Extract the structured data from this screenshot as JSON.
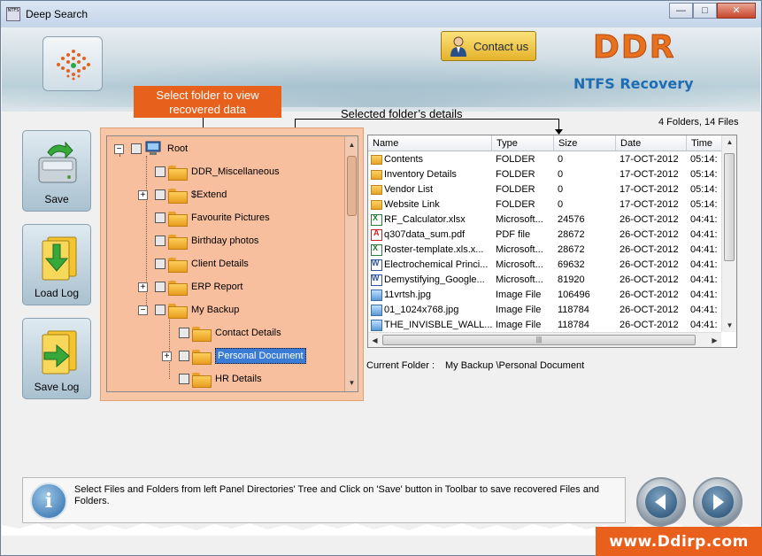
{
  "window": {
    "title": "Deep Search",
    "app_icon_text": "NTFS",
    "controls": {
      "minimize": "—",
      "maximize": "□",
      "close": "✕"
    }
  },
  "header": {
    "contact_label": "Contact us",
    "brand": "DDR",
    "product": "NTFS Recovery",
    "brand_color": "#e8711d",
    "product_color": "#1e6db3"
  },
  "toolbar": {
    "save_label": "Save",
    "load_log_label": "Load Log",
    "save_log_label": "Save Log"
  },
  "annotations": {
    "select_folder": "Select folder to view recovered data",
    "selected_details": "Selected folder’s details",
    "accent": "#e8611c"
  },
  "summary": "4 Folders,  14 Files",
  "tree": {
    "root": "Root",
    "items": [
      {
        "label": "DDR_Miscellaneous",
        "expander": ""
      },
      {
        "label": "$Extend",
        "expander": "+"
      },
      {
        "label": "Favourite Pictures",
        "expander": ""
      },
      {
        "label": "Birthday photos",
        "expander": ""
      },
      {
        "label": "Client Details",
        "expander": ""
      },
      {
        "label": "ERP Report",
        "expander": "+"
      },
      {
        "label": "My Backup",
        "expander": "−"
      },
      {
        "label": "Contact Details",
        "expander": ""
      },
      {
        "label": "Personal Document",
        "expander": "+",
        "selected": true
      },
      {
        "label": "HR Details",
        "expander": ""
      }
    ]
  },
  "files": {
    "columns": [
      "Name",
      "Type",
      "Size",
      "Date",
      "Time"
    ],
    "rows": [
      {
        "icon": "folder",
        "name": "Contents",
        "type": "FOLDER",
        "size": "0",
        "date": "17-OCT-2012",
        "time": "05:14:"
      },
      {
        "icon": "folder",
        "name": "Inventory Details",
        "type": "FOLDER",
        "size": "0",
        "date": "17-OCT-2012",
        "time": "05:14:"
      },
      {
        "icon": "folder",
        "name": "Vendor List",
        "type": "FOLDER",
        "size": "0",
        "date": "17-OCT-2012",
        "time": "05:14:"
      },
      {
        "icon": "folder",
        "name": "Website Link",
        "type": "FOLDER",
        "size": "0",
        "date": "17-OCT-2012",
        "time": "05:14:"
      },
      {
        "icon": "xls",
        "name": "RF_Calculator.xlsx",
        "type": "Microsoft...",
        "size": "24576",
        "date": "26-OCT-2012",
        "time": "04:41:"
      },
      {
        "icon": "pdf",
        "name": "q307data_sum.pdf",
        "type": "PDF file",
        "size": "28672",
        "date": "26-OCT-2012",
        "time": "04:41:"
      },
      {
        "icon": "xls",
        "name": "Roster-template.xls.x...",
        "type": "Microsoft...",
        "size": "28672",
        "date": "26-OCT-2012",
        "time": "04:41:"
      },
      {
        "icon": "doc",
        "name": "Electrochemical Princi...",
        "type": "Microsoft...",
        "size": "69632",
        "date": "26-OCT-2012",
        "time": "04:41:"
      },
      {
        "icon": "doc",
        "name": "Demystifying_Google...",
        "type": "Microsoft...",
        "size": "81920",
        "date": "26-OCT-2012",
        "time": "04:41:"
      },
      {
        "icon": "img",
        "name": "11vrtsh.jpg",
        "type": "Image File",
        "size": "106496",
        "date": "26-OCT-2012",
        "time": "04:41:"
      },
      {
        "icon": "img",
        "name": "01_1024x768.jpg",
        "type": "Image File",
        "size": "118784",
        "date": "26-OCT-2012",
        "time": "04:41:"
      },
      {
        "icon": "img",
        "name": "THE_INVISBLE_WALL...",
        "type": "Image File",
        "size": "118784",
        "date": "26-OCT-2012",
        "time": "04:41:"
      }
    ]
  },
  "current_folder": {
    "label": "Current Folder :",
    "value": "My Backup \\Personal Document"
  },
  "status": {
    "text": "Select Files and Folders from left Panel Directories' Tree and Click on 'Save' button in Toolbar to save recovered Files and Folders."
  },
  "website": "www.Ddirp.com"
}
